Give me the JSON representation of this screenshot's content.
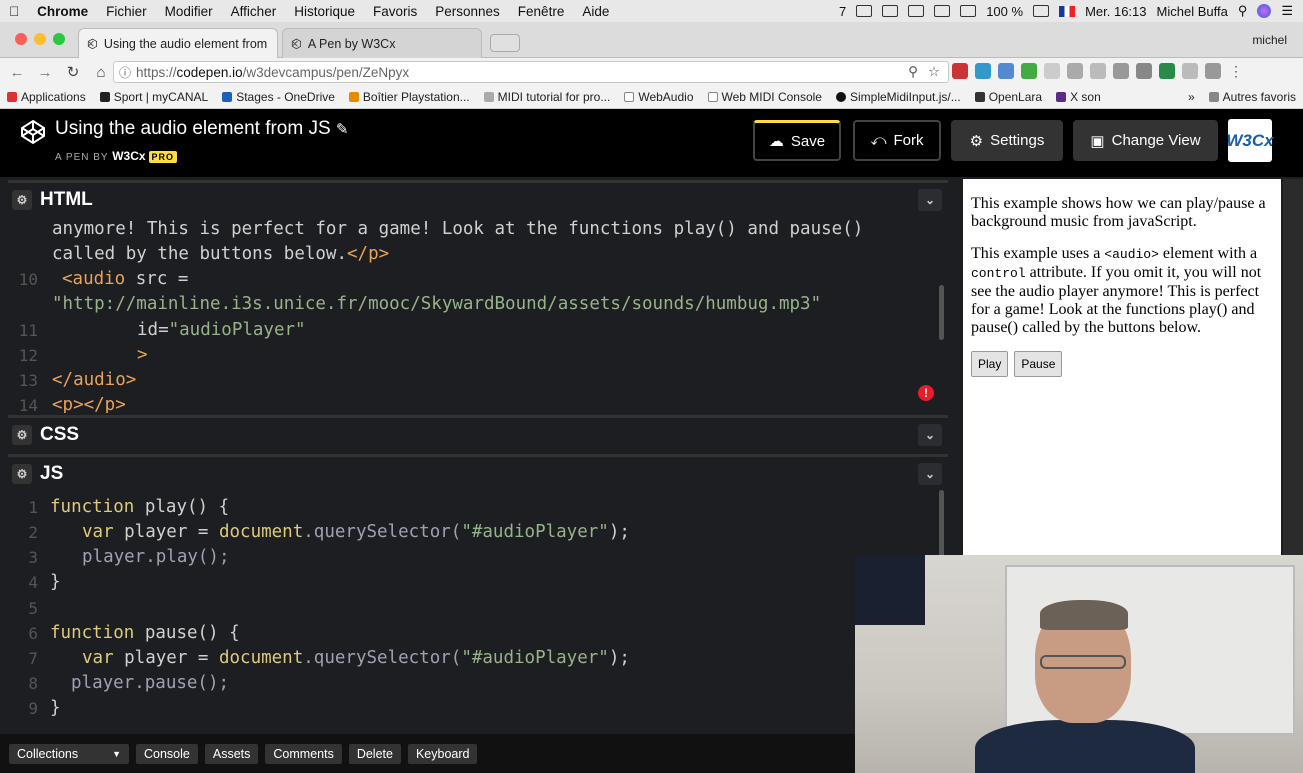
{
  "menubar": {
    "items": [
      "Chrome",
      "Fichier",
      "Modifier",
      "Afficher",
      "Historique",
      "Favoris",
      "Personnes",
      "Fenêtre",
      "Aide"
    ],
    "right_status": [
      "7",
      "100 %",
      "Mer. 16:13",
      "Michel Buffa"
    ]
  },
  "tabs": [
    {
      "label": "Using the audio element from",
      "close": "×"
    },
    {
      "label": "A Pen by W3Cx",
      "close": "×"
    }
  ],
  "profile": "michel",
  "address": {
    "scheme": "https://",
    "host": "codepen.io",
    "path": "/w3devcampus/pen/ZeNpyx"
  },
  "bookmarks": [
    "Applications",
    "Sport | myCANAL",
    "Stages - OneDrive",
    "Boîtier Playstation...",
    "MIDI tutorial for pro...",
    "WebAudio",
    "Web MIDI Console",
    "SimpleMidiInput.js/...",
    "OpenLara",
    "X son"
  ],
  "bookmarks_more": "»",
  "bookmarks_other": "Autres favoris",
  "pen": {
    "title": "Using the audio element from JS",
    "by_label": "A PEN BY",
    "author": "W3Cx",
    "badge": "PRO"
  },
  "header_buttons": {
    "save": "Save",
    "fork": "Fork",
    "settings": "Settings",
    "change_view": "Change View",
    "w3cx": "W3Cx"
  },
  "panes": {
    "html": "HTML",
    "css": "CSS",
    "js": "JS"
  },
  "html_code": {
    "line_a": "anymore! This is perfect for a game! Look at the functions play() and pause()",
    "line_b_text": "called by the buttons below.",
    "line_b_tag": "</p>",
    "n10": "10",
    "line10_tag": "<audio",
    "line10_attr": " src =",
    "line_url": "\"http://mainline.i3s.unice.fr/mooc/SkywardBound/assets/sounds/humbug.mp3\"",
    "n11": "11",
    "line11_attr": "id=",
    "line11_val": "\"audioPlayer\"",
    "n12": "12",
    "line12": ">",
    "n13": "13",
    "line13": "</audio>",
    "n14": "14",
    "line14": "<p></p>",
    "error": "!"
  },
  "js_code": {
    "n1": "1",
    "n2": "2",
    "n3": "3",
    "n4": "4",
    "n5": "5",
    "n6": "6",
    "n7": "7",
    "n8": "8",
    "n9": "9",
    "kw_function": "function",
    "fn_play": " play() {",
    "fn_pause": " pause() {",
    "kw_var": "var",
    "player_decl": " player = ",
    "doc": "document",
    ".qs": ".querySelector(",
    "sel": "\"#audioPlayer\"",
    "close_paren": ");",
    "play_call": "player.play();",
    "pause_call": "player.pause();",
    "brace": "}"
  },
  "preview": {
    "p1": "This example shows how we can play/pause a background music from javaScript.",
    "p2_a": "This example uses a ",
    "p2_code1": "<audio>",
    "p2_b": " element with a ",
    "p2_code2": "control",
    "p2_c": " attribute. If you omit it, you will not see the audio player anymore! This is perfect for a game! Look at the functions play() and pause() called by the buttons below.",
    "play_btn": "Play",
    "pause_btn": "Pause"
  },
  "footer": [
    "Collections",
    "Console",
    "Assets",
    "Comments",
    "Delete",
    "Keyboard"
  ],
  "colors": {
    "accent_yellow": "#ffdd40",
    "error_red": "#e81d2c",
    "editor_bg": "#1d1e22",
    "keyword": "#ddca7e",
    "string": "#96b38a",
    "tag": "#e6a35a"
  }
}
